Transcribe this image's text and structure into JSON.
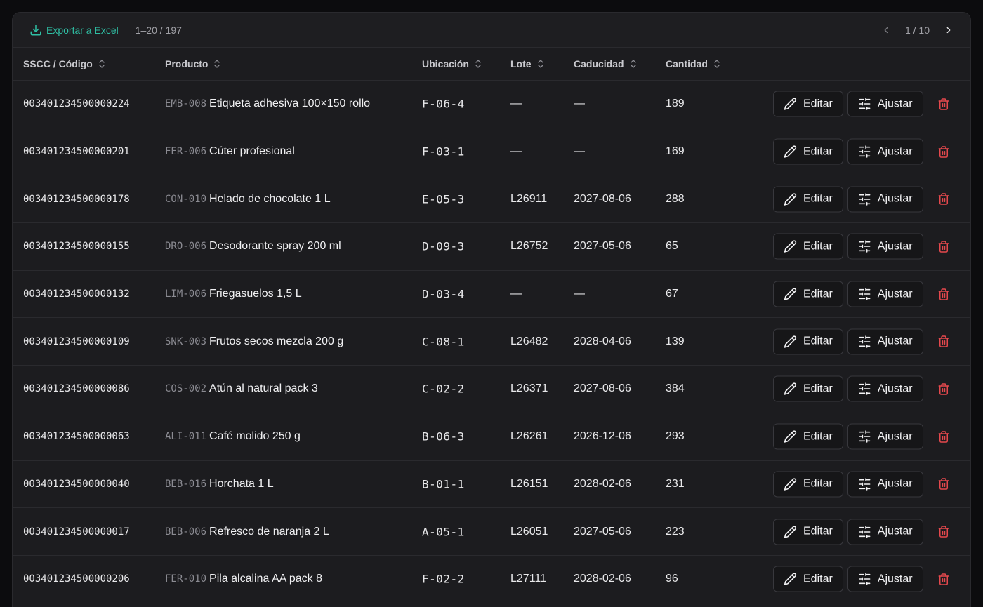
{
  "toolbar": {
    "export_label": "Exportar a Excel",
    "range": "1–20 / 197",
    "page_indicator": "1 / 10"
  },
  "columns": {
    "sscc": "SSCC / Código",
    "producto": "Producto",
    "ubicacion": "Ubicación",
    "lote": "Lote",
    "caducidad": "Caducidad",
    "cantidad": "Cantidad"
  },
  "actions": {
    "edit_label": "Editar",
    "adjust_label": "Ajustar"
  },
  "colors": {
    "accent": "#2fbfa4",
    "danger": "#e5484d",
    "background": "#1c1c1f"
  },
  "rows": [
    {
      "sscc": "003401234500000224",
      "code": "EMB-008",
      "name": "Etiqueta adhesiva 100×150 rollo",
      "ubicacion": "F-06-4",
      "lote": "—",
      "caducidad": "—",
      "cantidad": "189"
    },
    {
      "sscc": "003401234500000201",
      "code": "FER-006",
      "name": "Cúter profesional",
      "ubicacion": "F-03-1",
      "lote": "—",
      "caducidad": "—",
      "cantidad": "169"
    },
    {
      "sscc": "003401234500000178",
      "code": "CON-010",
      "name": "Helado de chocolate 1 L",
      "ubicacion": "E-05-3",
      "lote": "L26911",
      "caducidad": "2027-08-06",
      "cantidad": "288"
    },
    {
      "sscc": "003401234500000155",
      "code": "DRO-006",
      "name": "Desodorante spray 200 ml",
      "ubicacion": "D-09-3",
      "lote": "L26752",
      "caducidad": "2027-05-06",
      "cantidad": "65"
    },
    {
      "sscc": "003401234500000132",
      "code": "LIM-006",
      "name": "Friegasuelos 1,5 L",
      "ubicacion": "D-03-4",
      "lote": "—",
      "caducidad": "—",
      "cantidad": "67"
    },
    {
      "sscc": "003401234500000109",
      "code": "SNK-003",
      "name": "Frutos secos mezcla 200 g",
      "ubicacion": "C-08-1",
      "lote": "L26482",
      "caducidad": "2028-04-06",
      "cantidad": "139"
    },
    {
      "sscc": "003401234500000086",
      "code": "COS-002",
      "name": "Atún al natural pack 3",
      "ubicacion": "C-02-2",
      "lote": "L26371",
      "caducidad": "2027-08-06",
      "cantidad": "384"
    },
    {
      "sscc": "003401234500000063",
      "code": "ALI-011",
      "name": "Café molido 250 g",
      "ubicacion": "B-06-3",
      "lote": "L26261",
      "caducidad": "2026-12-06",
      "cantidad": "293"
    },
    {
      "sscc": "003401234500000040",
      "code": "BEB-016",
      "name": "Horchata 1 L",
      "ubicacion": "B-01-1",
      "lote": "L26151",
      "caducidad": "2028-02-06",
      "cantidad": "231"
    },
    {
      "sscc": "003401234500000017",
      "code": "BEB-006",
      "name": "Refresco de naranja 2 L",
      "ubicacion": "A-05-1",
      "lote": "L26051",
      "caducidad": "2027-05-06",
      "cantidad": "223"
    },
    {
      "sscc": "003401234500000206",
      "code": "FER-010",
      "name": "Pila alcalina AA pack 8",
      "ubicacion": "F-02-2",
      "lote": "L27111",
      "caducidad": "2028-02-06",
      "cantidad": "96"
    }
  ]
}
